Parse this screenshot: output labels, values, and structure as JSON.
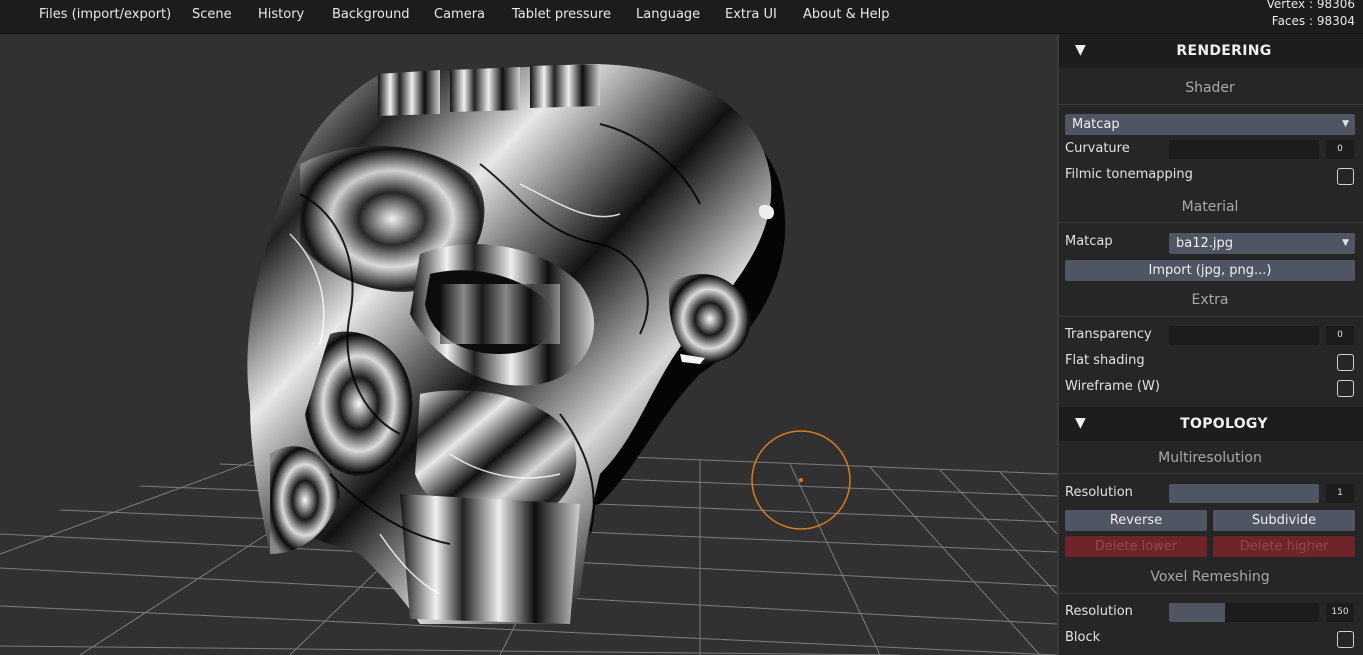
{
  "menu": [
    "Files (import/export)",
    "Scene",
    "History",
    "Background",
    "Camera",
    "Tablet pressure",
    "Language",
    "Extra UI",
    "About & Help"
  ],
  "stats": {
    "vertex": "Vertex : 98306",
    "faces": "Faces : 98304"
  },
  "colors": {
    "brush_cursor": "#e07a1f",
    "button": "#4f5563",
    "disabled_button": "#6e2428"
  },
  "rendering": {
    "title": "RENDERING",
    "shader": {
      "heading": "Shader",
      "value": "Matcap",
      "curvature_label": "Curvature",
      "curvature_value": "0",
      "curvature_level": 0,
      "filmic_label": "Filmic tonemapping",
      "filmic_checked": false
    },
    "material": {
      "heading": "Material",
      "matcap_label": "Matcap",
      "matcap_value": "ba12.jpg",
      "import_label": "Import (jpg, png...)"
    },
    "extra": {
      "heading": "Extra",
      "transparency_label": "Transparency",
      "transparency_value": "0",
      "transparency_level": 0,
      "flat_label": "Flat shading",
      "flat_checked": false,
      "wireframe_label": "Wireframe (W)",
      "wireframe_checked": false
    }
  },
  "topology": {
    "title": "TOPOLOGY",
    "multires": {
      "heading": "Multiresolution",
      "resolution_label": "Resolution",
      "resolution_value": "1",
      "resolution_level": 1.0,
      "reverse_label": "Reverse",
      "subdivide_label": "Subdivide",
      "delete_lower_label": "Delete lower",
      "delete_higher_label": "Delete higher"
    },
    "voxel": {
      "heading": "Voxel Remeshing",
      "resolution_label": "Resolution",
      "resolution_value": "150",
      "resolution_level": 0.37,
      "block_label": "Block",
      "block_checked": false
    }
  }
}
